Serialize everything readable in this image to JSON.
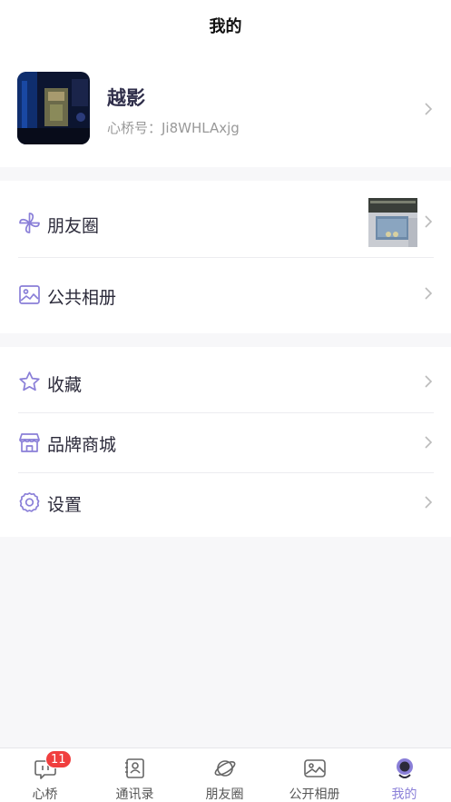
{
  "header": {
    "title": "我的"
  },
  "profile": {
    "name": "越影",
    "id_label": "心桥号：Ji8WHLAxjg",
    "avatar_icon": "user-photo-avatar"
  },
  "menu": {
    "group1": [
      {
        "label": "朋友圈",
        "icon": "pinwheel-icon",
        "has_thumbnail": true
      },
      {
        "label": "公共相册",
        "icon": "image-icon"
      }
    ],
    "group2": [
      {
        "label": "收藏",
        "icon": "star-icon"
      },
      {
        "label": "品牌商城",
        "icon": "store-icon"
      },
      {
        "label": "设置",
        "icon": "gear-icon"
      }
    ]
  },
  "tabbar": {
    "items": [
      {
        "label": "心桥",
        "icon": "chat-bubble-icon",
        "badge": "11"
      },
      {
        "label": "通讯录",
        "icon": "contacts-icon"
      },
      {
        "label": "朋友圈",
        "icon": "planet-icon"
      },
      {
        "label": "公开相册",
        "icon": "album-icon"
      },
      {
        "label": "我的",
        "icon": "profile-icon",
        "active": true
      }
    ]
  },
  "colors": {
    "accent": "#8a7fd8",
    "badge": "#f03e3e",
    "background": "#f7f7f9"
  }
}
